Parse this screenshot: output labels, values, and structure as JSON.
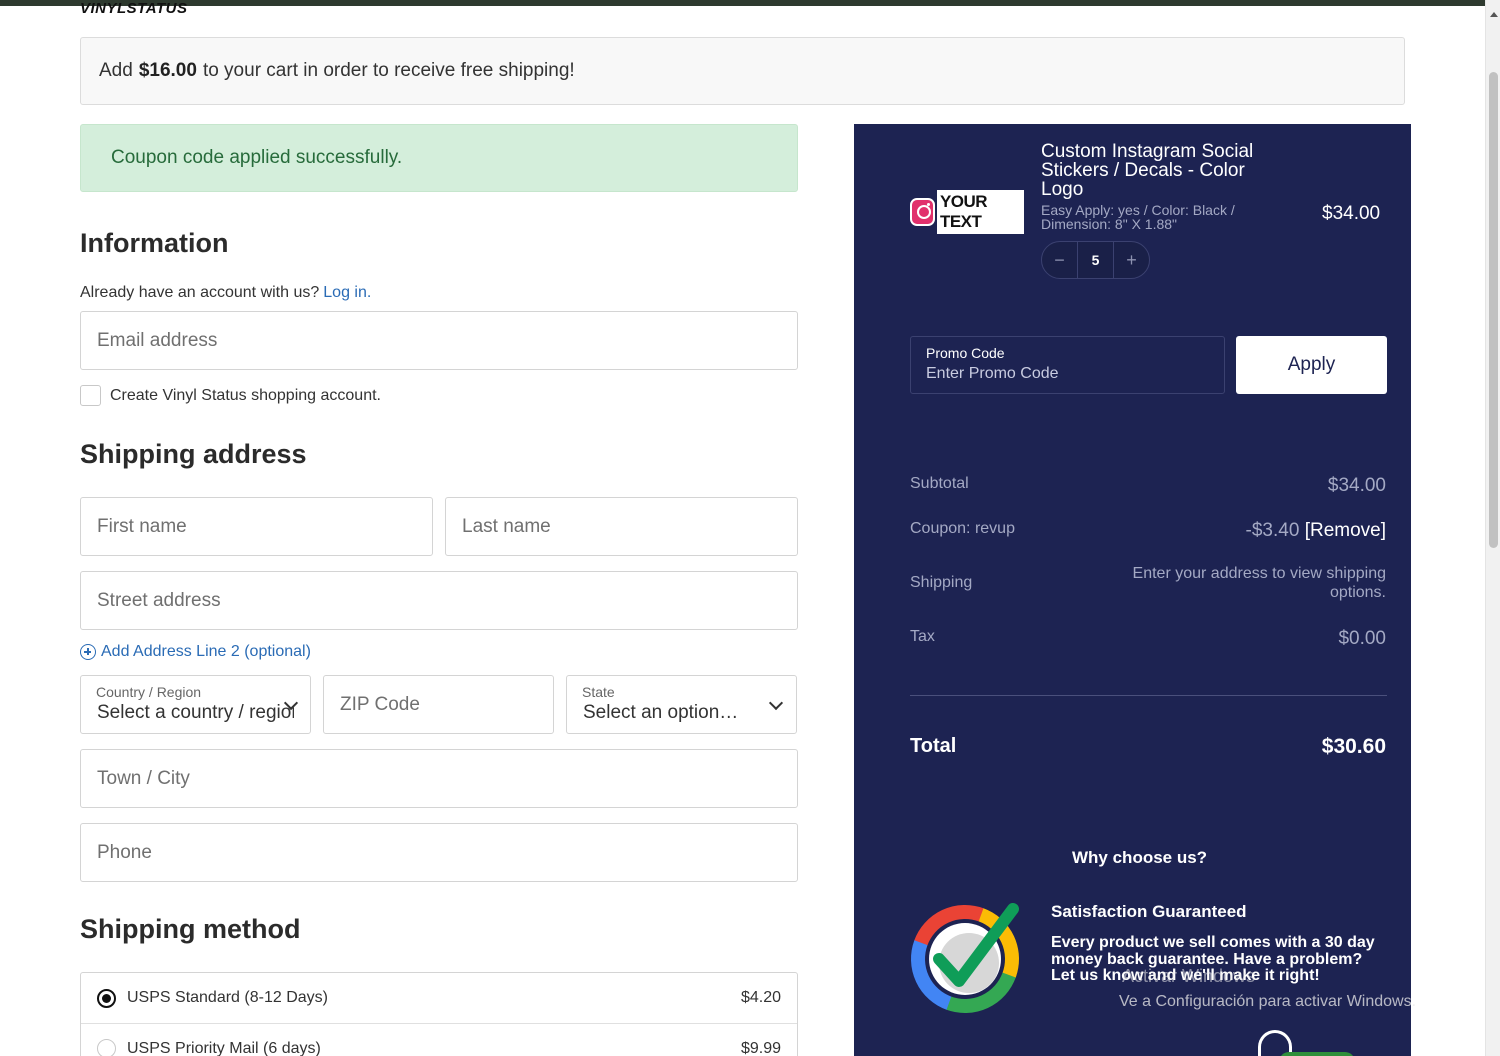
{
  "logo": "VINYLSTATUS",
  "shipping_banner": {
    "prefix": "Add",
    "amount": "$16.00",
    "suffix": "to your cart in order to receive free shipping!"
  },
  "coupon_notice": "Coupon code applied successfully.",
  "information": {
    "heading": "Information",
    "account_prompt": "Already have an account with us?",
    "login_link": "Log in.",
    "email_placeholder": "Email address",
    "create_account_label": "Create Vinyl Status shopping account."
  },
  "shipping_address": {
    "heading": "Shipping address",
    "first_name_placeholder": "First name",
    "last_name_placeholder": "Last name",
    "street_placeholder": "Street address",
    "add_line2": "Add Address Line 2 (optional)",
    "country_label": "Country / Region",
    "country_value": "Select a country / region",
    "zip_placeholder": "ZIP Code",
    "state_label": "State",
    "state_value": "Select an option…",
    "city_placeholder": "Town / City",
    "phone_placeholder": "Phone"
  },
  "shipping_method": {
    "heading": "Shipping method",
    "options": [
      {
        "label": "USPS Standard (8-12 Days)",
        "price": "$4.20",
        "selected": true
      },
      {
        "label": "USPS Priority Mail (6 days)",
        "price": "$9.99",
        "selected": false
      }
    ]
  },
  "summary": {
    "product": {
      "image_text": "YOUR TEXT",
      "title": "Custom Instagram Social Stickers / Decals - Color Logo",
      "options": "Easy Apply: yes / Color: Black / Dimension: 8\" X 1.88\"",
      "price": "$34.00",
      "quantity": "5",
      "minus": "−",
      "plus": "+"
    },
    "promo": {
      "label": "Promo Code",
      "placeholder": "Enter Promo Code",
      "apply_label": "Apply"
    },
    "subtotal_label": "Subtotal",
    "subtotal_value": "$34.00",
    "coupon_label": "Coupon: revup",
    "coupon_value": "-$3.40",
    "coupon_remove": "[Remove]",
    "shipping_label": "Shipping",
    "shipping_value": "Enter your address to view shipping options.",
    "tax_label": "Tax",
    "tax_value": "$0.00",
    "total_label": "Total",
    "total_value": "$30.60",
    "why_heading": "Why choose us?",
    "guarantee_title": "Satisfaction Guaranteed",
    "guarantee_text": "Every product we sell comes with a 30 day money back guarantee. Have a problem? Let us know and we'll make it right!"
  },
  "windows_watermark": {
    "line1": "Activar Windows",
    "line2": "Ve a Configuración para activar Windows."
  },
  "colors": {
    "summary_bg": "#1d2352",
    "link": "#2a6bb5",
    "success_bg": "#d4eedb",
    "success_text": "#276b3b"
  }
}
